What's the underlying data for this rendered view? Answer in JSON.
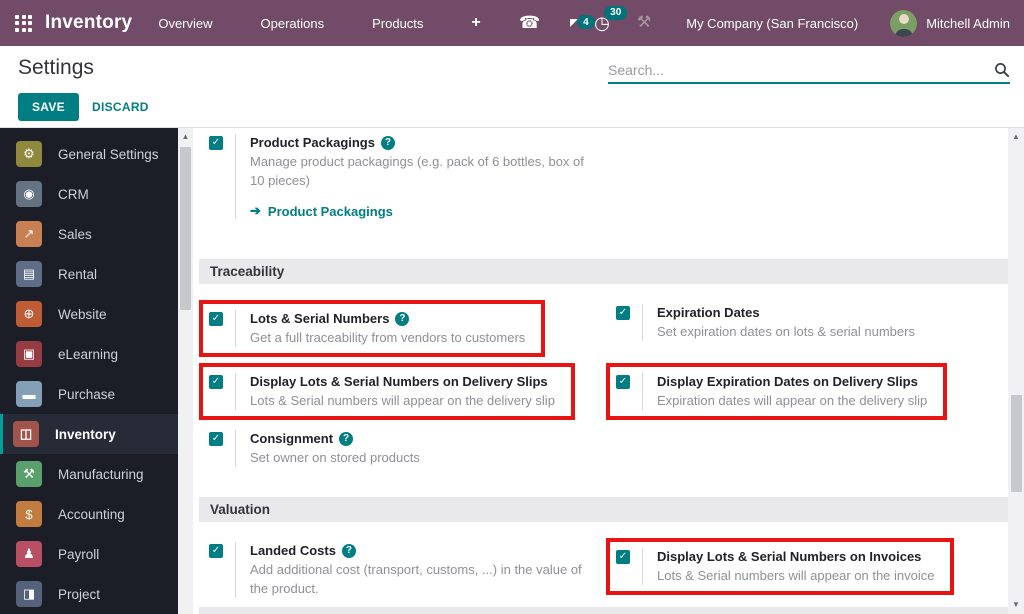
{
  "navbar": {
    "app_name": "Inventory",
    "menus": [
      "Overview",
      "Operations",
      "Products"
    ],
    "plus_label": "+",
    "badges": {
      "messages": "4",
      "activities": "30"
    },
    "company": "My Company (San Francisco)",
    "user": "Mitchell Admin"
  },
  "header": {
    "title": "Settings",
    "save_label": "SAVE",
    "discard_label": "DISCARD",
    "search_placeholder": "Search..."
  },
  "icons": {
    "phone": "☎",
    "clock": "◷",
    "tools": "⚒",
    "check": "✓",
    "help": "?",
    "link_arrow": "➔",
    "scroll_up": "▲",
    "scroll_down": "▼"
  },
  "colors": {
    "navbar": "#714b67",
    "accent_teal": "#017e84",
    "badge_teal": "#00737b",
    "highlight_red": "#e81313",
    "sidebar_bg": "#1b1e26"
  },
  "sidebar": {
    "items": [
      {
        "label": "General Settings",
        "icon_name": "gear-icon",
        "glyph": "⚙",
        "color": "#8f883d",
        "selected": false
      },
      {
        "label": "CRM",
        "icon_name": "crm-icon",
        "glyph": "◉",
        "color": "#647282",
        "selected": false
      },
      {
        "label": "Sales",
        "icon_name": "sales-chart-icon",
        "glyph": "↗",
        "color": "#c87f52",
        "selected": false
      },
      {
        "label": "Rental",
        "icon_name": "rental-icon",
        "glyph": "▤",
        "color": "#5f6d86",
        "selected": false
      },
      {
        "label": "Website",
        "icon_name": "globe-icon",
        "glyph": "⊕",
        "color": "#bf5b35",
        "selected": false
      },
      {
        "label": "eLearning",
        "icon_name": "elearning-icon",
        "glyph": "▣",
        "color": "#963d44",
        "selected": false
      },
      {
        "label": "Purchase",
        "icon_name": "purchase-card-icon",
        "glyph": "▬",
        "color": "#84a0b8",
        "selected": false
      },
      {
        "label": "Inventory",
        "icon_name": "inventory-box-icon",
        "glyph": "◫",
        "color": "#a1544a",
        "selected": true
      },
      {
        "label": "Manufacturing",
        "icon_name": "wrench-icon",
        "glyph": "⚒",
        "color": "#5aa06c",
        "selected": false
      },
      {
        "label": "Accounting",
        "icon_name": "accounting-icon",
        "glyph": "$",
        "color": "#c27c3f",
        "selected": false
      },
      {
        "label": "Payroll",
        "icon_name": "payroll-icon",
        "glyph": "♟",
        "color": "#b84f64",
        "selected": false
      },
      {
        "label": "Project",
        "icon_name": "project-icon",
        "glyph": "◨",
        "color": "#56627c",
        "selected": false
      }
    ]
  },
  "content": {
    "top_setting": {
      "label": "Product Packagings",
      "help": true,
      "desc": "Manage product packagings (e.g. pack of 6 bottles, box of 10 pieces)",
      "link": "Product Packagings",
      "checked": true,
      "highlight": false
    },
    "sections": [
      {
        "title": "Traceability",
        "rows": [
          [
            {
              "label": "Lots & Serial Numbers",
              "help": true,
              "desc": "Get a full traceability from vendors to customers",
              "checked": true,
              "highlight": true
            },
            {
              "label": "Expiration Dates",
              "help": false,
              "desc": "Set expiration dates on lots & serial numbers",
              "checked": true,
              "highlight": false
            }
          ],
          [
            {
              "label": "Display Lots & Serial Numbers on Delivery Slips",
              "help": false,
              "desc": "Lots & Serial numbers will appear on the delivery slip",
              "checked": true,
              "highlight": true
            },
            {
              "label": "Display Expiration Dates on Delivery Slips",
              "help": false,
              "desc": "Expiration dates will appear on the delivery slip",
              "checked": true,
              "highlight": true
            }
          ],
          [
            {
              "label": "Consignment",
              "help": true,
              "desc": "Set owner on stored products",
              "checked": true,
              "highlight": false
            },
            null
          ]
        ]
      },
      {
        "title": "Valuation",
        "rows": [
          [
            {
              "label": "Landed Costs",
              "help": true,
              "desc": "Add additional cost (transport, customs, ...) in the value of the product.",
              "checked": true,
              "highlight": false
            },
            {
              "label": "Display Lots & Serial Numbers on Invoices",
              "help": false,
              "desc": "Lots & Serial numbers will appear on the invoice",
              "checked": true,
              "highlight": true
            }
          ]
        ]
      }
    ]
  }
}
